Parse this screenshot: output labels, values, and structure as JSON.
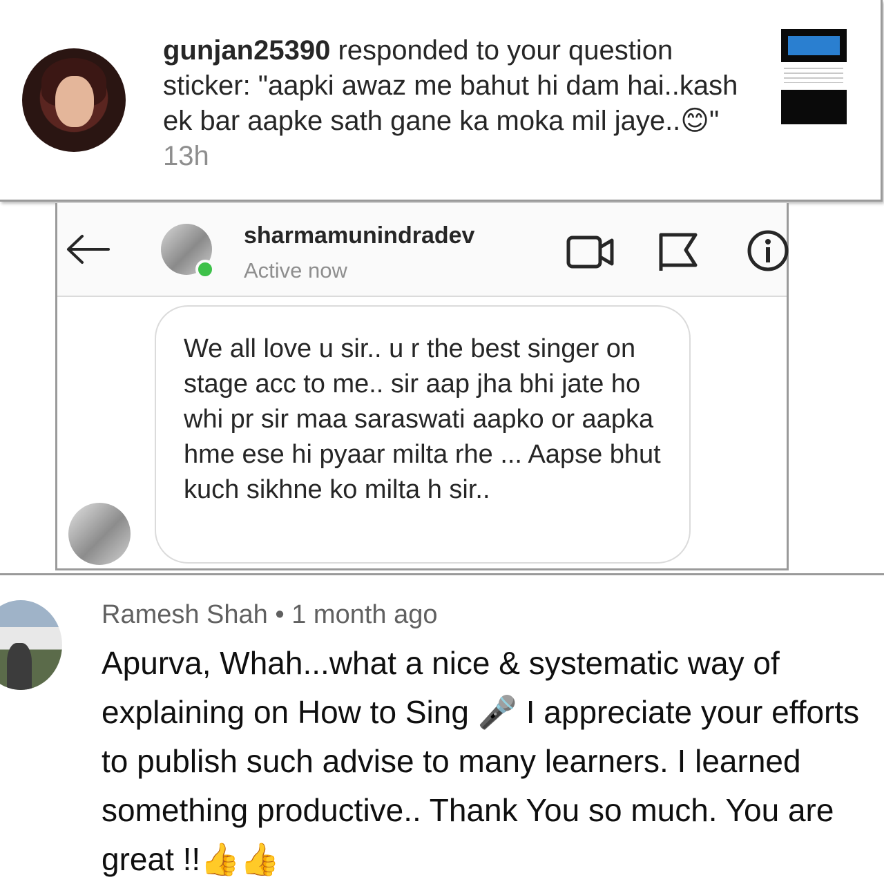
{
  "notification": {
    "username": "gunjan25390",
    "text": " responded to your question sticker: \"aapki awaz me bahut hi dam hai..kash ek bar aapke sath gane ka moka mil jaye..😊\" ",
    "time": "13h"
  },
  "dm": {
    "username": "sharmamunindradev",
    "status": "Active now",
    "message": "We all love u sir.. u r the best singer on stage acc to me.. sir aap jha bhi jate ho whi pr sir maa saraswati aapko or aapka hme ese hi pyaar milta rhe ... Aapse bhut kuch sikhne ko milta h sir..",
    "icons": [
      "back-arrow-icon",
      "video-call-icon",
      "flag-icon",
      "info-icon"
    ],
    "online_color": "#3ec14a"
  },
  "comment": {
    "author": "Ramesh Shah",
    "separator": " • ",
    "time": "1 month ago",
    "body": "Apurva, Whah...what a nice & systematic way of explaining on How to Sing 🎤  I appreciate your efforts to publish such advise to many learners. I learned something productive.. Thank You so much. You are great !!👍👍"
  }
}
